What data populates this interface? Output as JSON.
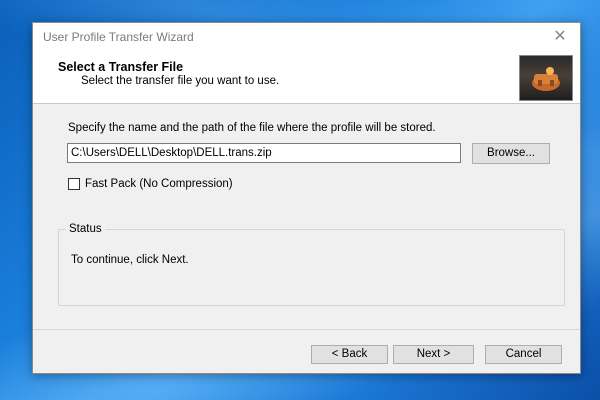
{
  "window": {
    "title": "User Profile Transfer Wizard",
    "close_icon": "close-icon"
  },
  "header": {
    "title": "Select a Transfer File",
    "subtitle": "Select the transfer file you want to use.",
    "image_icon": "wizard-header-image"
  },
  "body": {
    "instruction": "Specify the name and the path of the file where the profile will be stored.",
    "path_value": "C:\\Users\\DELL\\Desktop\\DELL.trans.zip",
    "browse_label": "Browse...",
    "fast_pack_label": "Fast Pack (No Compression)",
    "fast_pack_checked": false
  },
  "status": {
    "legend": "Status",
    "text": "To continue, click Next."
  },
  "footer": {
    "back_label": "< Back",
    "next_label": "Next >",
    "cancel_label": "Cancel"
  }
}
